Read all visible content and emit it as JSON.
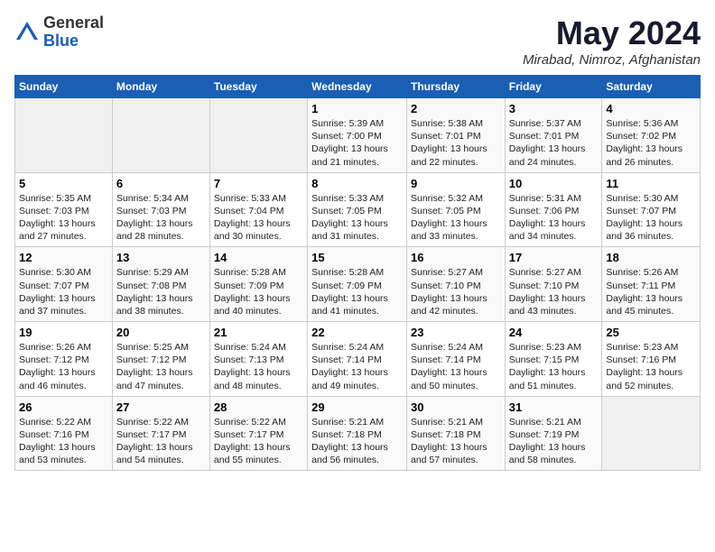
{
  "header": {
    "logo_general": "General",
    "logo_blue": "Blue",
    "title": "May 2024",
    "location": "Mirabad, Nimroz, Afghanistan"
  },
  "days_of_week": [
    "Sunday",
    "Monday",
    "Tuesday",
    "Wednesday",
    "Thursday",
    "Friday",
    "Saturday"
  ],
  "weeks": [
    [
      {
        "day": "",
        "info": ""
      },
      {
        "day": "",
        "info": ""
      },
      {
        "day": "",
        "info": ""
      },
      {
        "day": "1",
        "info": "Sunrise: 5:39 AM\nSunset: 7:00 PM\nDaylight: 13 hours\nand 21 minutes."
      },
      {
        "day": "2",
        "info": "Sunrise: 5:38 AM\nSunset: 7:01 PM\nDaylight: 13 hours\nand 22 minutes."
      },
      {
        "day": "3",
        "info": "Sunrise: 5:37 AM\nSunset: 7:01 PM\nDaylight: 13 hours\nand 24 minutes."
      },
      {
        "day": "4",
        "info": "Sunrise: 5:36 AM\nSunset: 7:02 PM\nDaylight: 13 hours\nand 26 minutes."
      }
    ],
    [
      {
        "day": "5",
        "info": "Sunrise: 5:35 AM\nSunset: 7:03 PM\nDaylight: 13 hours\nand 27 minutes."
      },
      {
        "day": "6",
        "info": "Sunrise: 5:34 AM\nSunset: 7:03 PM\nDaylight: 13 hours\nand 28 minutes."
      },
      {
        "day": "7",
        "info": "Sunrise: 5:33 AM\nSunset: 7:04 PM\nDaylight: 13 hours\nand 30 minutes."
      },
      {
        "day": "8",
        "info": "Sunrise: 5:33 AM\nSunset: 7:05 PM\nDaylight: 13 hours\nand 31 minutes."
      },
      {
        "day": "9",
        "info": "Sunrise: 5:32 AM\nSunset: 7:05 PM\nDaylight: 13 hours\nand 33 minutes."
      },
      {
        "day": "10",
        "info": "Sunrise: 5:31 AM\nSunset: 7:06 PM\nDaylight: 13 hours\nand 34 minutes."
      },
      {
        "day": "11",
        "info": "Sunrise: 5:30 AM\nSunset: 7:07 PM\nDaylight: 13 hours\nand 36 minutes."
      }
    ],
    [
      {
        "day": "12",
        "info": "Sunrise: 5:30 AM\nSunset: 7:07 PM\nDaylight: 13 hours\nand 37 minutes."
      },
      {
        "day": "13",
        "info": "Sunrise: 5:29 AM\nSunset: 7:08 PM\nDaylight: 13 hours\nand 38 minutes."
      },
      {
        "day": "14",
        "info": "Sunrise: 5:28 AM\nSunset: 7:09 PM\nDaylight: 13 hours\nand 40 minutes."
      },
      {
        "day": "15",
        "info": "Sunrise: 5:28 AM\nSunset: 7:09 PM\nDaylight: 13 hours\nand 41 minutes."
      },
      {
        "day": "16",
        "info": "Sunrise: 5:27 AM\nSunset: 7:10 PM\nDaylight: 13 hours\nand 42 minutes."
      },
      {
        "day": "17",
        "info": "Sunrise: 5:27 AM\nSunset: 7:10 PM\nDaylight: 13 hours\nand 43 minutes."
      },
      {
        "day": "18",
        "info": "Sunrise: 5:26 AM\nSunset: 7:11 PM\nDaylight: 13 hours\nand 45 minutes."
      }
    ],
    [
      {
        "day": "19",
        "info": "Sunrise: 5:26 AM\nSunset: 7:12 PM\nDaylight: 13 hours\nand 46 minutes."
      },
      {
        "day": "20",
        "info": "Sunrise: 5:25 AM\nSunset: 7:12 PM\nDaylight: 13 hours\nand 47 minutes."
      },
      {
        "day": "21",
        "info": "Sunrise: 5:24 AM\nSunset: 7:13 PM\nDaylight: 13 hours\nand 48 minutes."
      },
      {
        "day": "22",
        "info": "Sunrise: 5:24 AM\nSunset: 7:14 PM\nDaylight: 13 hours\nand 49 minutes."
      },
      {
        "day": "23",
        "info": "Sunrise: 5:24 AM\nSunset: 7:14 PM\nDaylight: 13 hours\nand 50 minutes."
      },
      {
        "day": "24",
        "info": "Sunrise: 5:23 AM\nSunset: 7:15 PM\nDaylight: 13 hours\nand 51 minutes."
      },
      {
        "day": "25",
        "info": "Sunrise: 5:23 AM\nSunset: 7:16 PM\nDaylight: 13 hours\nand 52 minutes."
      }
    ],
    [
      {
        "day": "26",
        "info": "Sunrise: 5:22 AM\nSunset: 7:16 PM\nDaylight: 13 hours\nand 53 minutes."
      },
      {
        "day": "27",
        "info": "Sunrise: 5:22 AM\nSunset: 7:17 PM\nDaylight: 13 hours\nand 54 minutes."
      },
      {
        "day": "28",
        "info": "Sunrise: 5:22 AM\nSunset: 7:17 PM\nDaylight: 13 hours\nand 55 minutes."
      },
      {
        "day": "29",
        "info": "Sunrise: 5:21 AM\nSunset: 7:18 PM\nDaylight: 13 hours\nand 56 minutes."
      },
      {
        "day": "30",
        "info": "Sunrise: 5:21 AM\nSunset: 7:18 PM\nDaylight: 13 hours\nand 57 minutes."
      },
      {
        "day": "31",
        "info": "Sunrise: 5:21 AM\nSunset: 7:19 PM\nDaylight: 13 hours\nand 58 minutes."
      },
      {
        "day": "",
        "info": ""
      }
    ]
  ]
}
